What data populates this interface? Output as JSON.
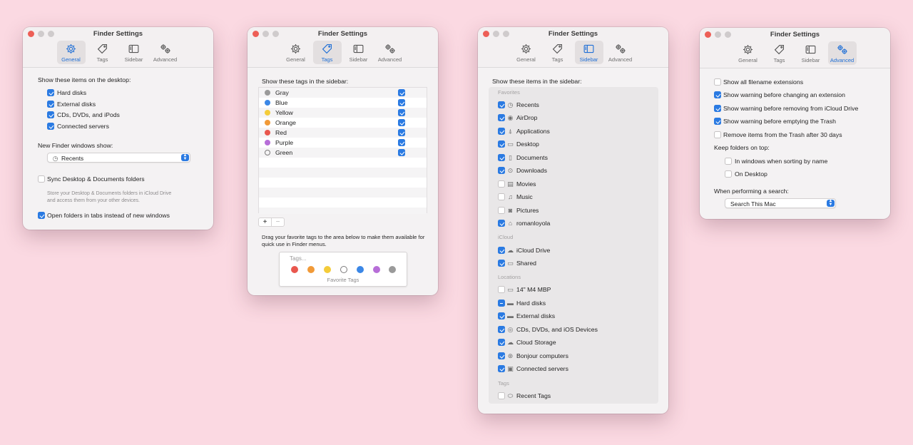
{
  "window_title": "Finder Settings",
  "toolbar": {
    "general": "General",
    "tags": "Tags",
    "sidebar": "Sidebar",
    "advanced": "Advanced"
  },
  "general": {
    "desktop_heading": "Show these items on the desktop:",
    "desktop_items": [
      {
        "label": "Hard disks",
        "checked": true
      },
      {
        "label": "External disks",
        "checked": true
      },
      {
        "label": "CDs, DVDs, and iPods",
        "checked": true
      },
      {
        "label": "Connected servers",
        "checked": true
      }
    ],
    "new_window_heading": "New Finder windows show:",
    "new_window_value": "Recents",
    "sync_label": "Sync Desktop & Documents folders",
    "sync_note": "Store your Desktop & Documents folders in iCloud Drive and access them from your other devices.",
    "tabs_label": "Open folders in tabs instead of new windows"
  },
  "tags": {
    "heading": "Show these tags in the sidebar:",
    "items": [
      {
        "label": "Gray",
        "color": "#9a9a9a"
      },
      {
        "label": "Blue",
        "color": "#3b87e6"
      },
      {
        "label": "Yellow",
        "color": "#f4cc3a"
      },
      {
        "label": "Orange",
        "color": "#f19a38"
      },
      {
        "label": "Red",
        "color": "#e9574e"
      },
      {
        "label": "Purple",
        "color": "#b76ed8"
      },
      {
        "label": "Green",
        "color": ""
      }
    ],
    "add": "+",
    "remove": "−",
    "drag_note": "Drag your favorite tags to the area below to make them available for quick use in Finder menus.",
    "tags_placeholder": "Tags...",
    "favorite_colors": [
      "#e9574e",
      "#f19a38",
      "#f4cc3a",
      "",
      "#3b87e6",
      "#b76ed8",
      "#9a9a9a"
    ],
    "favorite_label": "Favorite Tags"
  },
  "sidebar": {
    "heading": "Show these items in the sidebar:",
    "sections": [
      {
        "title": "Favorites",
        "items": [
          {
            "label": "Recents",
            "state": "on",
            "icon": "clock-icon"
          },
          {
            "label": "AirDrop",
            "state": "on",
            "icon": "airdrop-icon"
          },
          {
            "label": "Applications",
            "state": "on",
            "icon": "applications-icon"
          },
          {
            "label": "Desktop",
            "state": "on",
            "icon": "desktop-icon"
          },
          {
            "label": "Documents",
            "state": "on",
            "icon": "document-icon"
          },
          {
            "label": "Downloads",
            "state": "on",
            "icon": "download-icon"
          },
          {
            "label": "Movies",
            "state": "off",
            "icon": "film-icon"
          },
          {
            "label": "Music",
            "state": "off",
            "icon": "music-icon"
          },
          {
            "label": "Pictures",
            "state": "off",
            "icon": "camera-icon"
          },
          {
            "label": "romanloyola",
            "state": "on",
            "icon": "home-icon"
          }
        ]
      },
      {
        "title": "iCloud",
        "items": [
          {
            "label": "iCloud Drive",
            "state": "on",
            "icon": "cloud-icon"
          },
          {
            "label": "Shared",
            "state": "on",
            "icon": "shared-folder-icon"
          }
        ]
      },
      {
        "title": "Locations",
        "items": [
          {
            "label": "14\" M4 MBP",
            "state": "off",
            "icon": "laptop-icon"
          },
          {
            "label": "Hard disks",
            "state": "mixed",
            "icon": "disk-icon"
          },
          {
            "label": "External disks",
            "state": "on",
            "icon": "disk-icon"
          },
          {
            "label": "CDs, DVDs, and iOS Devices",
            "state": "on",
            "icon": "cd-icon"
          },
          {
            "label": "Cloud Storage",
            "state": "on",
            "icon": "cloud-icon"
          },
          {
            "label": "Bonjour computers",
            "state": "on",
            "icon": "bonjour-icon"
          },
          {
            "label": "Connected servers",
            "state": "on",
            "icon": "server-icon"
          }
        ]
      },
      {
        "title": "Tags",
        "items": [
          {
            "label": "Recent Tags",
            "state": "off",
            "icon": "tag-icon"
          }
        ]
      }
    ]
  },
  "advanced": {
    "items": [
      {
        "label": "Show all filename extensions",
        "checked": false
      },
      {
        "label": "Show warning before changing an extension",
        "checked": true
      },
      {
        "label": "Show warning before removing from iCloud Drive",
        "checked": true
      },
      {
        "label": "Show warning before emptying the Trash",
        "checked": true
      },
      {
        "label": "Remove items from the Trash after 30 days",
        "checked": false
      }
    ],
    "keep_heading": "Keep folders on top:",
    "keep_items": [
      {
        "label": "In windows when sorting by name",
        "checked": false
      },
      {
        "label": "On Desktop",
        "checked": false
      }
    ],
    "search_heading": "When performing a search:",
    "search_value": "Search This Mac"
  }
}
